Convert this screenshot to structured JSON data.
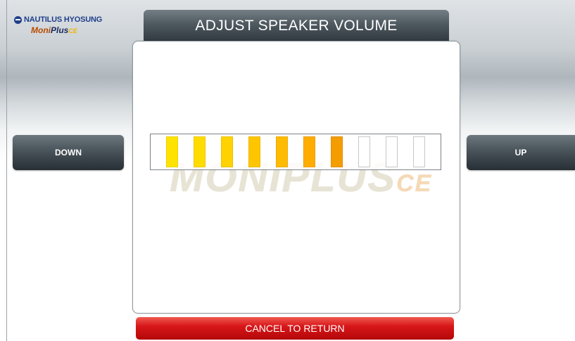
{
  "logo": {
    "brand_line": "NAUTILUS HYOSUNG",
    "product_moni": "Moni",
    "product_plus": "Plus",
    "product_ce": "CE",
    "icon": "globe-icon"
  },
  "title": "ADJUST SPEAKER VOLUME",
  "watermark": {
    "moni": "MONIPLUS",
    "ce": "CE"
  },
  "volume": {
    "level": 7,
    "max": 10,
    "colors": [
      "#ffe300",
      "#ffdc00",
      "#ffd200",
      "#ffc600",
      "#ffbb00",
      "#ffac00",
      "#f49d00"
    ]
  },
  "buttons": {
    "down": "DOWN",
    "up": "UP",
    "cancel": "CANCEL TO RETURN"
  }
}
